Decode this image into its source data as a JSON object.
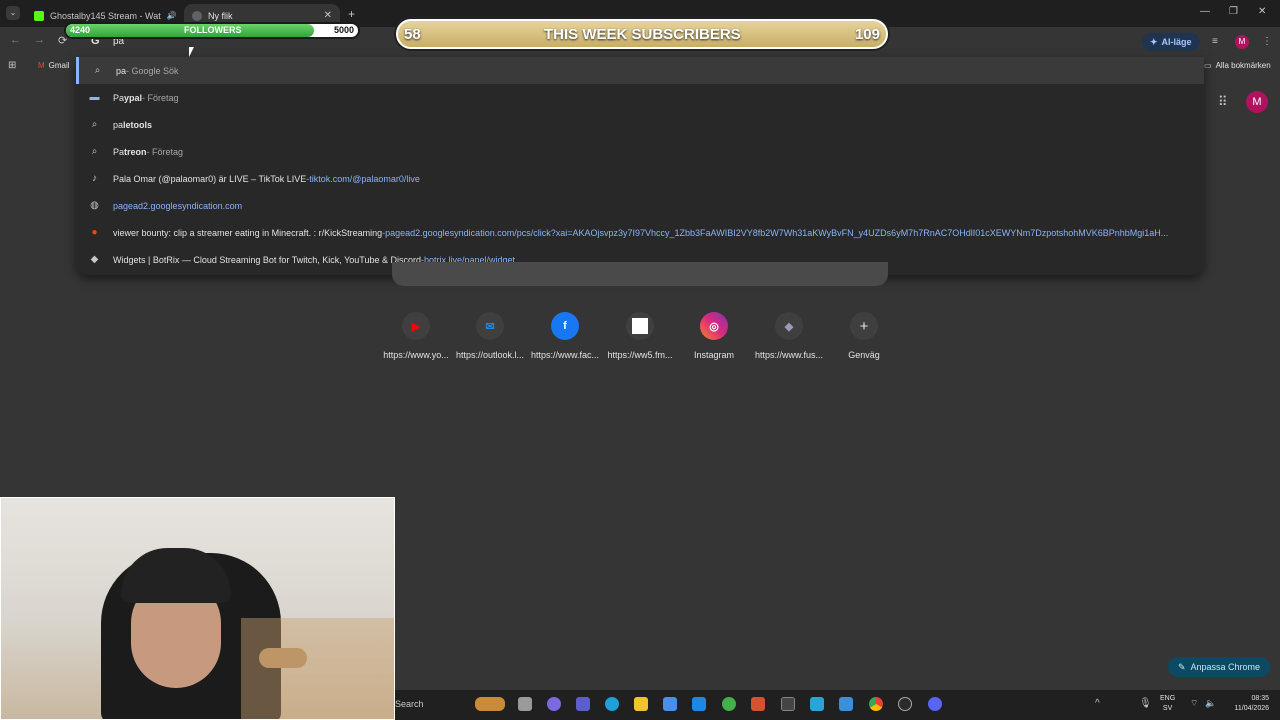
{
  "tabs": [
    {
      "label": "Ghostalby145 Stream - Wat",
      "active": false
    },
    {
      "label": "Ny flik",
      "active": true
    }
  ],
  "new_tab_symbol": "+",
  "window_controls": {
    "minimize": "—",
    "restore": "❐",
    "close": "✕"
  },
  "omnibox": {
    "value": "pa"
  },
  "ai_mode_label": "AI-läge",
  "bookmarks": {
    "gmail": "Gmail",
    "all_bookmarks": "Alla bokmärken"
  },
  "followers_bar": {
    "current": "4240",
    "label": "FOLLOWERS",
    "goal": "5000",
    "progress": 0.848
  },
  "subscribers_bar": {
    "left": "58",
    "label": "THIS WEEK SUBSCRIBERS",
    "right": "109"
  },
  "suggestions": [
    {
      "icon": "search-icon",
      "bold": "",
      "plain": "pa",
      "sub": " - Google Sök",
      "url": "",
      "selected": true
    },
    {
      "icon": "paypal-icon",
      "prefix": "Pa",
      "bold": "ypal",
      "sub": " - Företag",
      "url": ""
    },
    {
      "icon": "search-icon",
      "prefix": "pa",
      "bold": "letools",
      "sub": "",
      "url": ""
    },
    {
      "icon": "search-icon",
      "prefix": "Pa",
      "bold": "treon",
      "sub": " - Företag",
      "url": ""
    },
    {
      "icon": "tiktok-icon",
      "text": "Pala Omar (@palaomar0) är LIVE – TikTok LIVE",
      "sub": " - ",
      "url": "tiktok.com/@palaomar0/live"
    },
    {
      "icon": "globe-icon",
      "text": "",
      "sub": "",
      "url": "pagead2.googlesyndication.com"
    },
    {
      "icon": "reddit-icon",
      "text": "viewer bounty: clip a streamer eating in Minecraft. : r/KickStreaming",
      "sub": " - ",
      "url": "pagead2.googlesyndication.com/pcs/click?xai=AKAOjsvpz3y7I97Vhccy_1Zbb3FaAWIBI2VY8fb2W7Wh31aKWyBvFN_y4UZDs6yM7h7RnAC7OHdlI01cXEWYNm7DzpotshohMVK6BPnhbMgi1aH..."
    },
    {
      "icon": "botrix-icon",
      "text": "Widgets | BotRix — Cloud Streaming Bot for Twitch, Kick, YouTube & Discord",
      "sub": " - ",
      "url": "botrix.live/panel/widget"
    }
  ],
  "shortcuts": [
    {
      "label": "https://www.yo...",
      "icon": "youtube-icon",
      "color": "#ff0000"
    },
    {
      "label": "https://outlook.l...",
      "icon": "outlook-icon",
      "color": "#1e88e5"
    },
    {
      "label": "https://www.fac...",
      "icon": "facebook-icon",
      "color": "#1877f2"
    },
    {
      "label": "https://ww5.fm...",
      "icon": "page-icon",
      "color": "#ffffff"
    },
    {
      "label": "Instagram",
      "icon": "instagram-icon",
      "color": "#d6249f"
    },
    {
      "label": "https://www.fus...",
      "icon": "fusion-icon",
      "color": "#7a7a9a"
    },
    {
      "label": "Genväg",
      "icon": "plus-icon",
      "color": "#e3e3e3"
    }
  ],
  "customize_chrome": "Anpassa Chrome",
  "taskbar": {
    "search": "Search",
    "lang": "ENG",
    "lang2": "SV",
    "time": "08:35",
    "date": "11/04/2026"
  },
  "avatar_letter": "M"
}
